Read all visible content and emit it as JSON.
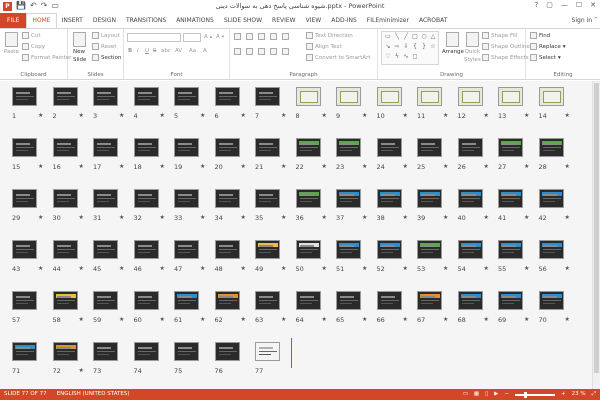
{
  "titlebar": {
    "app_icon": "P",
    "title": "شیوه شناسی پاسخ دهی به سوالات دینی.pptx - PowerPoint",
    "qat": [
      "save-icon",
      "undo-icon",
      "redo-icon",
      "start-from-beginning-icon"
    ],
    "help": "?",
    "restore": "▢",
    "minimize": "—",
    "maximize": "☐",
    "close": "✕"
  },
  "tabs": [
    {
      "label": "FILE",
      "kind": "file"
    },
    {
      "label": "HOME",
      "kind": "active"
    },
    {
      "label": "INSERT"
    },
    {
      "label": "DESIGN"
    },
    {
      "label": "TRANSITIONS"
    },
    {
      "label": "ANIMATIONS"
    },
    {
      "label": "SLIDE SHOW"
    },
    {
      "label": "REVIEW"
    },
    {
      "label": "VIEW"
    },
    {
      "label": "ADD-INS"
    },
    {
      "label": "FILEminimizer"
    },
    {
      "label": "ACROBAT"
    }
  ],
  "signin": "Sign in",
  "ribbon": {
    "clipboard": {
      "label": "Clipboard",
      "paste": "Paste",
      "cut": "Cut",
      "copy": "Copy",
      "format_painter": "Format Painter"
    },
    "slides": {
      "label": "Slides",
      "new_slide": "New",
      "new_slide2": "Slide",
      "layout": "Layout",
      "reset": "Reset",
      "section": "Section"
    },
    "font": {
      "label": "Font",
      "bold": "B",
      "italic": "I",
      "underline": "U",
      "strike": "S",
      "shadow": "abc",
      "spacing": "AV",
      "case": "Aa",
      "color": "A"
    },
    "paragraph": {
      "label": "Paragraph",
      "text_direction": "Text Direction",
      "align_text": "Align Text",
      "smartart": "Convert to SmartArt"
    },
    "drawing": {
      "label": "Drawing",
      "arrange": "Arrange",
      "quick_styles": "Quick",
      "quick_styles2": "Styles",
      "shape_fill": "Shape Fill",
      "shape_outline": "Shape Outline",
      "shape_effects": "Shape Effects"
    },
    "editing": {
      "label": "Editing",
      "find": "Find",
      "replace": "Replace",
      "select": "Select"
    }
  },
  "slides": {
    "count": 77,
    "light": [
      8,
      9,
      10,
      11,
      12,
      13,
      14
    ],
    "white": [
      77
    ],
    "accent": {
      "49": "yellow",
      "50": "white",
      "51": "blue",
      "52": "blue",
      "53": "green",
      "54": "blue",
      "55": "blue",
      "56": "blue",
      "58": "yellow",
      "61": "blue",
      "62": "orange",
      "67": "orange",
      "68": "blue",
      "69": "blue",
      "70": "blue",
      "71": "blue",
      "72": "orange",
      "36": "green",
      "37": "blue",
      "38": "blue",
      "39": "blue",
      "40": "blue",
      "41": "blue",
      "42": "blue",
      "22": "green",
      "23": "green",
      "27": "green",
      "28": "green"
    },
    "no_star": [
      73,
      74,
      75,
      76,
      77,
      57,
      71
    ]
  },
  "statusbar": {
    "slide": "SLIDE 77 OF 77",
    "language": "ENGLISH (UNITED STATES)",
    "zoom": "23 %",
    "zoom_fraction": 0.23
  }
}
